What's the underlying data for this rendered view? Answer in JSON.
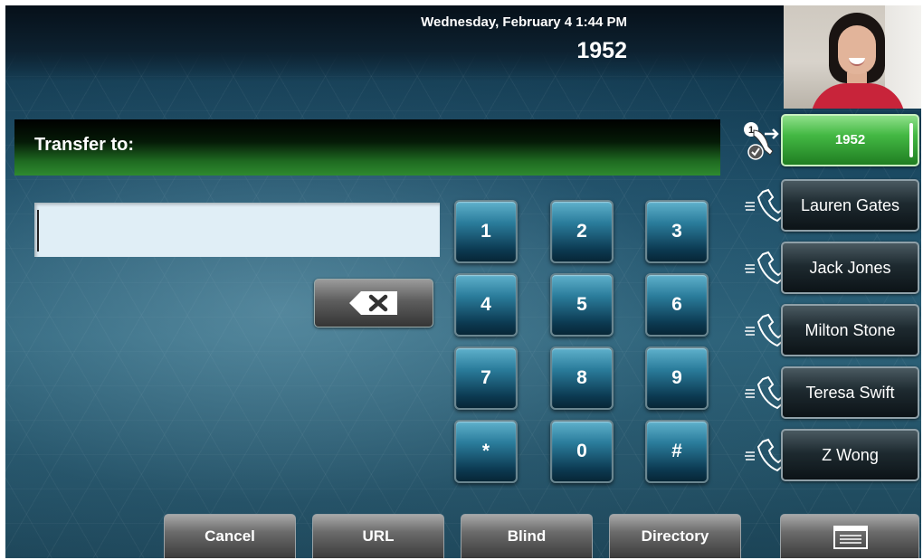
{
  "status_bar": {
    "datetime": "Wednesday, February 4  1:44 PM",
    "extension": "1952"
  },
  "transfer": {
    "title": "Transfer to:",
    "input_value": ""
  },
  "dialpad": {
    "keys": [
      "1",
      "2",
      "3",
      "4",
      "5",
      "6",
      "7",
      "8",
      "9",
      "*",
      "0",
      "#"
    ],
    "backspace_icon": "backspace-x-icon"
  },
  "lines": [
    {
      "label": "1952",
      "active": true,
      "icon": "transfer-call-icon",
      "badge": "1"
    },
    {
      "label": "Lauren Gates",
      "active": false,
      "icon": "handset-icon"
    },
    {
      "label": "Jack Jones",
      "active": false,
      "icon": "handset-icon"
    },
    {
      "label": "Milton Stone",
      "active": false,
      "icon": "handset-icon"
    },
    {
      "label": "Teresa Swift",
      "active": false,
      "icon": "handset-icon"
    },
    {
      "label": "Z Wong",
      "active": false,
      "icon": "handset-icon"
    }
  ],
  "softkeys": {
    "cancel": "Cancel",
    "url": "URL",
    "blind": "Blind",
    "directory": "Directory",
    "menu_icon": "menu-icon"
  },
  "colors": {
    "active_line": "#43b843",
    "banner_green": "#2e8a2f",
    "dialpad_key": "#2b7d9c"
  }
}
